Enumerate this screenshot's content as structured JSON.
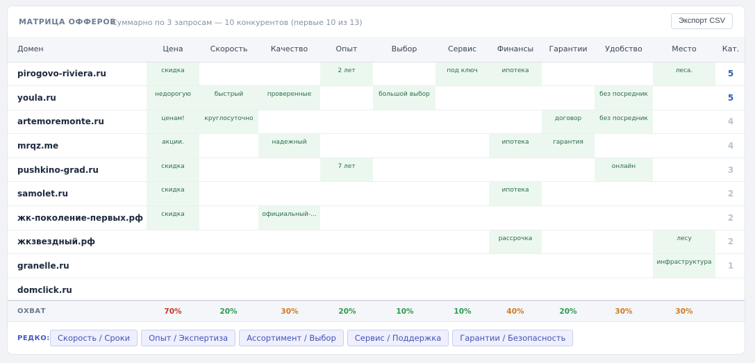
{
  "header": {
    "title": "МАТРИЦА ОФФЕРОВ",
    "subtitle": "Суммарно по 3 запросам — 10 конкурентов (первые 10 из 13)",
    "export_label": "Экспорт CSV"
  },
  "columns": {
    "domain": "Домен",
    "price": "Цена",
    "speed": "Скорость",
    "quality": "Качество",
    "experience": "Опыт",
    "choice": "Выбор",
    "service": "Сервис",
    "finance": "Финансы",
    "guarantee": "Гарантии",
    "convenience": "Удобство",
    "place": "Место",
    "count": "Кат."
  },
  "rows": [
    {
      "domain": "pirogovo-riviera.ru",
      "price": "скидка",
      "speed": "",
      "quality": "",
      "experience": "2 лет",
      "choice": "",
      "service": "под ключ",
      "finance": "ипотека",
      "guarantee": "",
      "convenience": "",
      "place": "леса.",
      "count": "5"
    },
    {
      "domain": "youla.ru",
      "price": "недорогую",
      "speed": "быстрый",
      "quality": "проверенные",
      "experience": "",
      "choice": "большой выбор",
      "service": "",
      "finance": "",
      "guarantee": "",
      "convenience": "без посредник",
      "place": "",
      "count": "5"
    },
    {
      "domain": "artemoremonte.ru",
      "price": "ценам!",
      "speed": "круглосуточно",
      "quality": "",
      "experience": "",
      "choice": "",
      "service": "",
      "finance": "",
      "guarantee": "договор",
      "convenience": "без посредник",
      "place": "",
      "count": "4"
    },
    {
      "domain": "mrqz.me",
      "price": "акции.",
      "speed": "",
      "quality": "надежный",
      "experience": "",
      "choice": "",
      "service": "",
      "finance": "ипотека",
      "guarantee": "гарантия",
      "convenience": "",
      "place": "",
      "count": "4"
    },
    {
      "domain": "pushkino-grad.ru",
      "price": "скидка",
      "speed": "",
      "quality": "",
      "experience": "7 лет",
      "choice": "",
      "service": "",
      "finance": "",
      "guarantee": "",
      "convenience": "онлайн",
      "place": "",
      "count": "3"
    },
    {
      "domain": "samolet.ru",
      "price": "скидка",
      "speed": "",
      "quality": "",
      "experience": "",
      "choice": "",
      "service": "",
      "finance": "ипотека",
      "guarantee": "",
      "convenience": "",
      "place": "",
      "count": "2"
    },
    {
      "domain": "жк-поколение-первых.рф",
      "price": "скидка",
      "speed": "",
      "quality": "официальный-...",
      "experience": "",
      "choice": "",
      "service": "",
      "finance": "",
      "guarantee": "",
      "convenience": "",
      "place": "",
      "count": "2"
    },
    {
      "domain": "жкзвездный.рф",
      "price": "",
      "speed": "",
      "quality": "",
      "experience": "",
      "choice": "",
      "service": "",
      "finance": "рассрочка",
      "guarantee": "",
      "convenience": "",
      "place": "лесу",
      "count": "2"
    },
    {
      "domain": "granelle.ru",
      "price": "",
      "speed": "",
      "quality": "",
      "experience": "",
      "choice": "",
      "service": "",
      "finance": "",
      "guarantee": "",
      "convenience": "",
      "place": "инфраструктура",
      "count": "1"
    },
    {
      "domain": "domclick.ru",
      "price": "",
      "speed": "",
      "quality": "",
      "experience": "",
      "choice": "",
      "service": "",
      "finance": "",
      "guarantee": "",
      "convenience": "",
      "place": "",
      "count": ""
    }
  ],
  "coverage": {
    "label": "ОХВАТ",
    "values": [
      {
        "key": "price",
        "text": "70%",
        "color": "#c0392b"
      },
      {
        "key": "speed",
        "text": "20%",
        "color": "#2e9a4f"
      },
      {
        "key": "quality",
        "text": "30%",
        "color": "#d07a1c"
      },
      {
        "key": "experience",
        "text": "20%",
        "color": "#2e9a4f"
      },
      {
        "key": "choice",
        "text": "10%",
        "color": "#2e9a4f"
      },
      {
        "key": "service",
        "text": "10%",
        "color": "#2e9a4f"
      },
      {
        "key": "finance",
        "text": "40%",
        "color": "#d07a1c"
      },
      {
        "key": "guarantee",
        "text": "20%",
        "color": "#2e9a4f"
      },
      {
        "key": "convenience",
        "text": "30%",
        "color": "#d07a1c"
      },
      {
        "key": "place",
        "text": "30%",
        "color": "#d07a1c"
      }
    ]
  },
  "rare": {
    "label": "РЕДКО:",
    "chips": [
      "Скорость / Сроки",
      "Опыт / Экспертиза",
      "Ассортимент / Выбор",
      "Сервис / Поддержка",
      "Гарантии / Безопасность"
    ]
  },
  "colors": {
    "hit_cell": "#ecf8ef",
    "count_high": "#2a5fb0",
    "count_low": "#b8c4d4",
    "chip_bg": "#eef0fd"
  }
}
